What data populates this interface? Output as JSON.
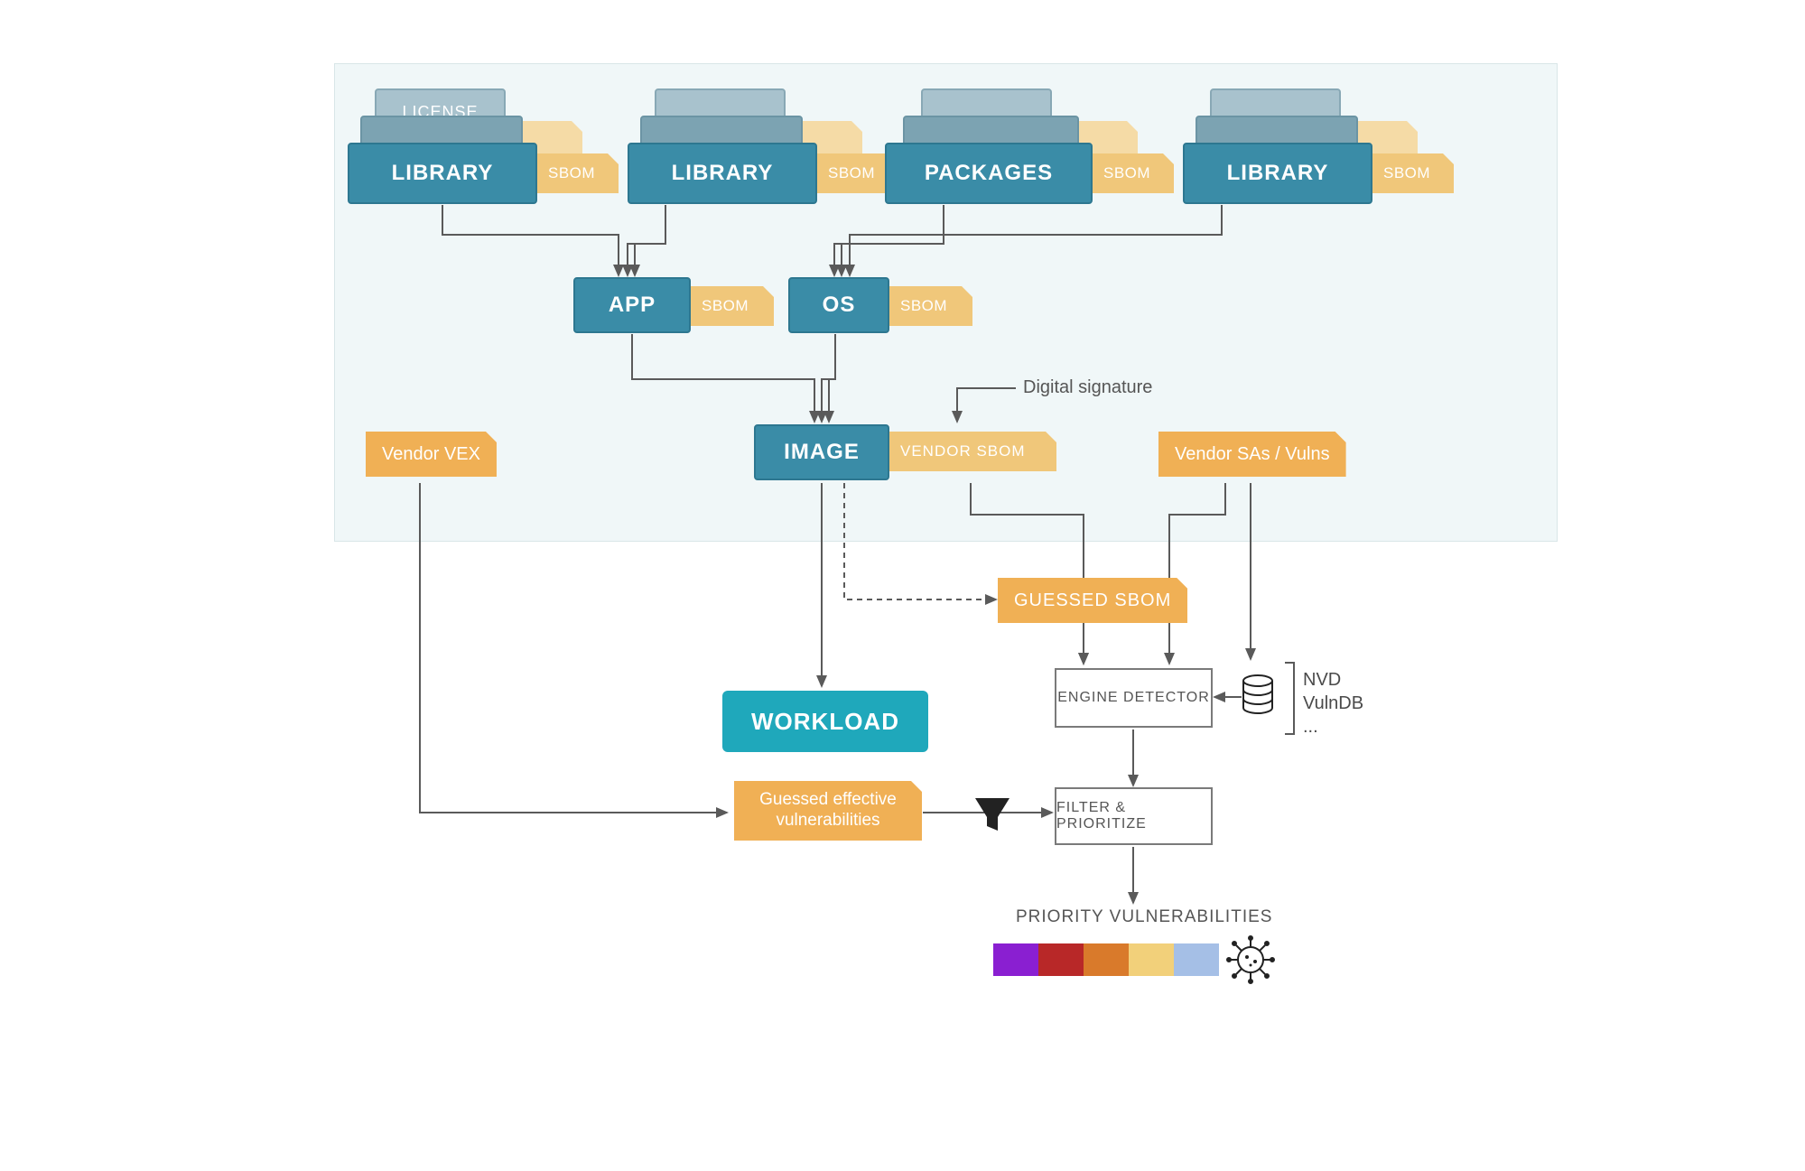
{
  "stacks": {
    "s1": {
      "back_label": "LICENSE",
      "front": "LIBRARY",
      "sbom": "SBOM"
    },
    "s2": {
      "front": "LIBRARY",
      "sbom": "SBOM"
    },
    "s3": {
      "front": "PACKAGES",
      "sbom": "SBOM"
    },
    "s4": {
      "front": "LIBRARY",
      "sbom": "SBOM"
    }
  },
  "mid": {
    "app": "APP",
    "app_sbom": "SBOM",
    "os": "OS",
    "os_sbom": "SBOM",
    "image": "IMAGE",
    "vendor_sbom": "VENDOR SBOM"
  },
  "annotations": {
    "digital_sig": "Digital signature"
  },
  "tags": {
    "vendor_vex": "Vendor VEX",
    "vendor_sas": "Vendor SAs / Vulns",
    "guessed_sbom": "GUESSED SBOM",
    "guessed_eff_line1": "Guessed effective",
    "guessed_eff_line2": "vulnerabilities"
  },
  "boxes": {
    "workload": "WORKLOAD",
    "engine_detector": "ENGINE DETECTOR",
    "filter_prioritize": "FILTER & PRIORITIZE"
  },
  "db": {
    "line1": "NVD",
    "line2": "VulnDB",
    "line3": "..."
  },
  "output": {
    "title": "PRIORITY VULNERABILITIES"
  },
  "severity_colors": [
    "#8a1fd1",
    "#b82828",
    "#d97a2b",
    "#f2d07a",
    "#a5bfe6"
  ]
}
